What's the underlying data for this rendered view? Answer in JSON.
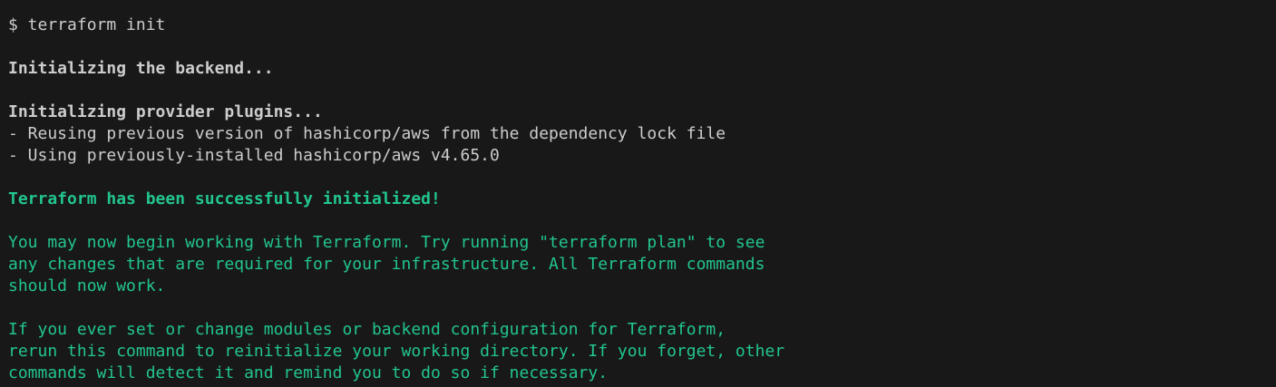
{
  "terminal": {
    "prompt_command": "$ terraform init",
    "backend_init": "Initializing the backend...",
    "provider_init": "Initializing provider plugins...",
    "provider_lines": [
      "- Reusing previous version of hashicorp/aws from the dependency lock file",
      "- Using previously-installed hashicorp/aws v4.65.0"
    ],
    "success": "Terraform has been successfully initialized!",
    "info_paragraph_1": [
      "You may now begin working with Terraform. Try running \"terraform plan\" to see",
      "any changes that are required for your infrastructure. All Terraform commands",
      "should now work."
    ],
    "info_paragraph_2": [
      "If you ever set or change modules or backend configuration for Terraform,",
      "rerun this command to reinitialize your working directory. If you forget, other",
      "commands will detect it and remind you to do so if necessary."
    ]
  },
  "colors": {
    "background": "#181818",
    "text": "#cccccc",
    "success": "#22c58e"
  }
}
